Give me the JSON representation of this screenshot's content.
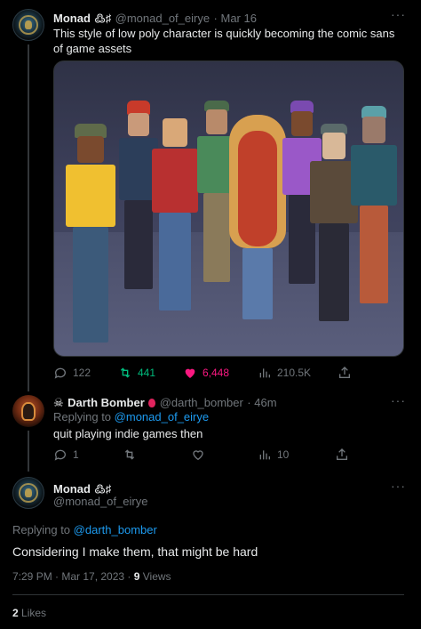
{
  "tweet1": {
    "author_name": "Monad",
    "author_badge": "߷♯",
    "author_handle": "@monad_of_eirye",
    "date": "· Mar 16",
    "text": "This style of low poly character is quickly becoming the comic sans of game assets",
    "media_description_icon": "low-poly-characters-image",
    "stats": {
      "replies": "122",
      "retweets": "441",
      "likes": "6,448",
      "views": "210.5K"
    }
  },
  "tweet2": {
    "author_name": "Darth Bomber",
    "author_prefix_icon": "☠",
    "author_suffix_icon": "balloon-icon",
    "author_handle": "@darth_bomber",
    "time": "· 46m",
    "replying_label": "Replying to",
    "replying_to": "@monad_of_eirye",
    "text": "quit playing indie games then",
    "stats": {
      "replies": "1",
      "retweets": "",
      "likes": "",
      "views": "10"
    }
  },
  "tweet3": {
    "author_name": "Monad",
    "author_badge": "߷♯",
    "author_handle": "@monad_of_eirye",
    "replying_label": "Replying to",
    "replying_to": "@darth_bomber",
    "text": "Considering I make them, that might be hard",
    "timestamp": "7:29 PM · Mar 17, 2023 · ",
    "view_count": "9",
    "view_label": "Views",
    "likes_count": "2",
    "likes_label": "Likes"
  },
  "more_icon": "···",
  "colors": {
    "background": "#000000",
    "text": "#e7e9ea",
    "muted": "#71767b",
    "link": "#1d9bf0",
    "retweet": "#00ba7c",
    "like": "#f91880",
    "divider": "#2f3336"
  }
}
